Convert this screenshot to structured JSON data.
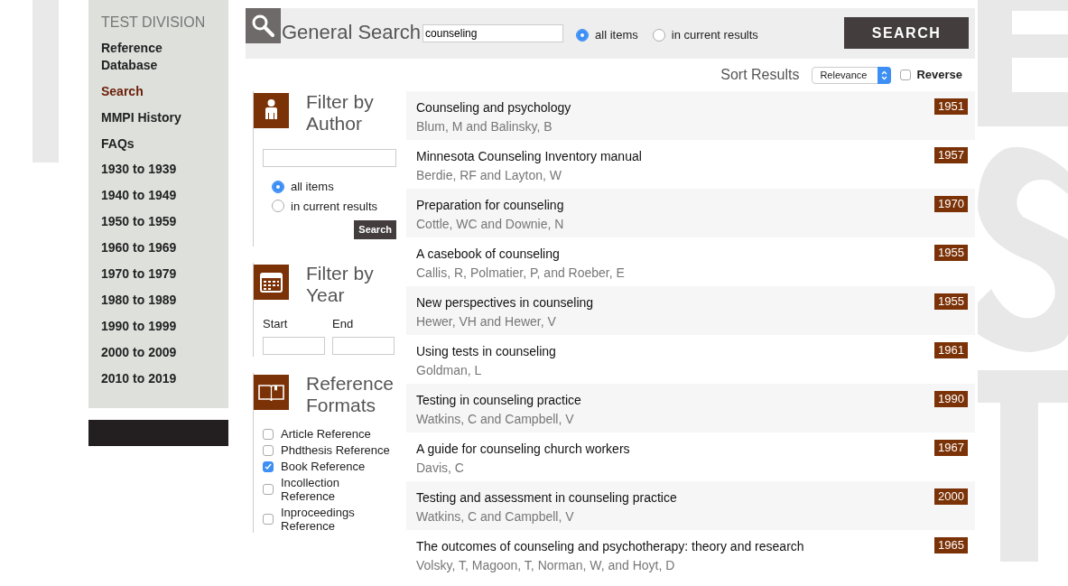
{
  "sidebar": {
    "title": "TEST DIVISION",
    "items": [
      {
        "label": "Reference Database",
        "selected": false
      },
      {
        "label": "Search",
        "selected": true
      },
      {
        "label": "MMPI History",
        "selected": false
      },
      {
        "label": "FAQs",
        "selected": false
      },
      {
        "label": "1930 to 1939",
        "selected": false
      },
      {
        "label": "1940 to 1949",
        "selected": false
      },
      {
        "label": "1950 to 1959",
        "selected": false
      },
      {
        "label": "1960 to 1969",
        "selected": false
      },
      {
        "label": "1970 to 1979",
        "selected": false
      },
      {
        "label": "1980 to 1989",
        "selected": false
      },
      {
        "label": "1990 to 1999",
        "selected": false
      },
      {
        "label": "2000 to 2009",
        "selected": false
      },
      {
        "label": "2010 to 2019",
        "selected": false
      }
    ]
  },
  "search": {
    "title": "General Search",
    "value": "counseling",
    "scope": [
      {
        "label": "all items",
        "selected": true
      },
      {
        "label": "in current results",
        "selected": false
      }
    ],
    "button": "SEARCH"
  },
  "sort": {
    "label": "Sort Results",
    "value": "Relevance",
    "reverse": {
      "label": "Reverse",
      "checked": false
    }
  },
  "filters": [
    {
      "kind": "author",
      "title": "Filter by Author",
      "scope": [
        {
          "label": "all items",
          "selected": true
        },
        {
          "label": "in current results",
          "selected": false
        }
      ],
      "button": "Search"
    },
    {
      "kind": "year",
      "title": "Filter by Year",
      "start_label": "Start",
      "end_label": "End"
    },
    {
      "kind": "formats",
      "title": "Reference Formats",
      "options": [
        {
          "label": "Article Reference",
          "checked": false
        },
        {
          "label": "Phdthesis Reference",
          "checked": false
        },
        {
          "label": "Book Reference",
          "checked": true
        },
        {
          "label": "Incollection Reference",
          "checked": false
        },
        {
          "label": "Inproceedings Reference",
          "checked": false
        }
      ]
    }
  ],
  "results": [
    {
      "title": "Counseling and psychology",
      "authors": "Blum, M and Balinsky, B",
      "year": "1951"
    },
    {
      "title": "Minnesota Counseling Inventory manual",
      "authors": "Berdie, RF and Layton, W",
      "year": "1957"
    },
    {
      "title": "Preparation for counseling",
      "authors": "Cottle, WC and Downie, N",
      "year": "1970"
    },
    {
      "title": "A casebook of counseling",
      "authors": "Callis, R, Polmatier, P, and Roeber, E",
      "year": "1955"
    },
    {
      "title": "New perspectives in counseling",
      "authors": "Hewer, VH and Hewer, V",
      "year": "1955"
    },
    {
      "title": "Using tests in counseling",
      "authors": "Goldman, L",
      "year": "1961"
    },
    {
      "title": "Testing in counseling practice",
      "authors": "Watkins, C and Campbell, V",
      "year": "1990"
    },
    {
      "title": "A guide for counseling church workers",
      "authors": "Davis, C",
      "year": "1967"
    },
    {
      "title": "Testing and assessment in counseling practice",
      "authors": "Watkins, C and Campbell, V",
      "year": "2000"
    },
    {
      "title": "The outcomes of counseling and psychotherapy: theory and research",
      "authors": "Volsky, T, Magoon, T, Norman, W, and Hoyt, D",
      "year": "1965"
    }
  ]
}
